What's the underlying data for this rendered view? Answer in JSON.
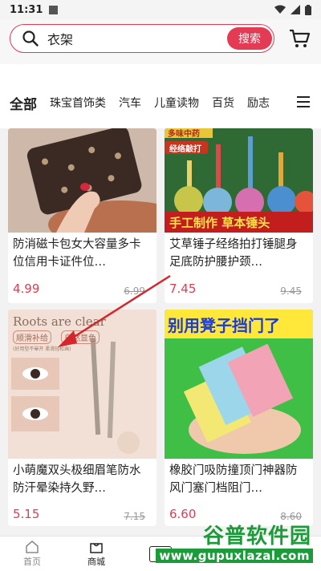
{
  "status_bar": {
    "time": "11:31"
  },
  "search": {
    "query": "衣架",
    "button_label": "搜索"
  },
  "tabs": [
    {
      "label": "全部",
      "active": true
    },
    {
      "label": "珠宝首饰类"
    },
    {
      "label": "汽车"
    },
    {
      "label": "儿童读物"
    },
    {
      "label": "百货"
    },
    {
      "label": "励志"
    }
  ],
  "products": [
    {
      "title": "防消磁卡包女大容量多卡位信用卡证件位…",
      "price": "4.99",
      "original_price": "6.99"
    },
    {
      "title": "艾草锤子经络拍打锤腿身足底防护腰护颈…",
      "price": "7.45",
      "original_price": "9.45",
      "image_text": {
        "top_banner": "多味中药",
        "sub_banner": "经络敲打",
        "bottom_banner": "手工制作 草本锤头"
      }
    },
    {
      "title": "小萌魔双头极细眉笔防水防汗晕染持久野…",
      "price": "5.15",
      "original_price": "7.15",
      "image_text": {
        "headline": "Roots are clear",
        "tag": "顺滑补给",
        "tag2": "自然显色",
        "fine_print": "(好用型不晕开 柔滑轻松画)"
      }
    },
    {
      "title": "橡胶门吸防撞顶门神器防风门塞门档阻门…",
      "price": "6.60",
      "original_price": "8.60",
      "image_text": {
        "banner": "别用凳子挡门了"
      }
    }
  ],
  "bottom_nav": [
    {
      "label": "首页",
      "icon": "home-icon",
      "active": false
    },
    {
      "label": "商城",
      "icon": "shop-bag-icon",
      "active": true
    },
    {
      "label": "",
      "icon": "plus-icon",
      "active": false
    }
  ],
  "watermark": {
    "name": "谷普软件园",
    "url": "www.gupuxlazal.com"
  },
  "colors": {
    "accent": "#e23b53",
    "price": "#e23b53",
    "watermark_green": "#1d9b3b"
  }
}
